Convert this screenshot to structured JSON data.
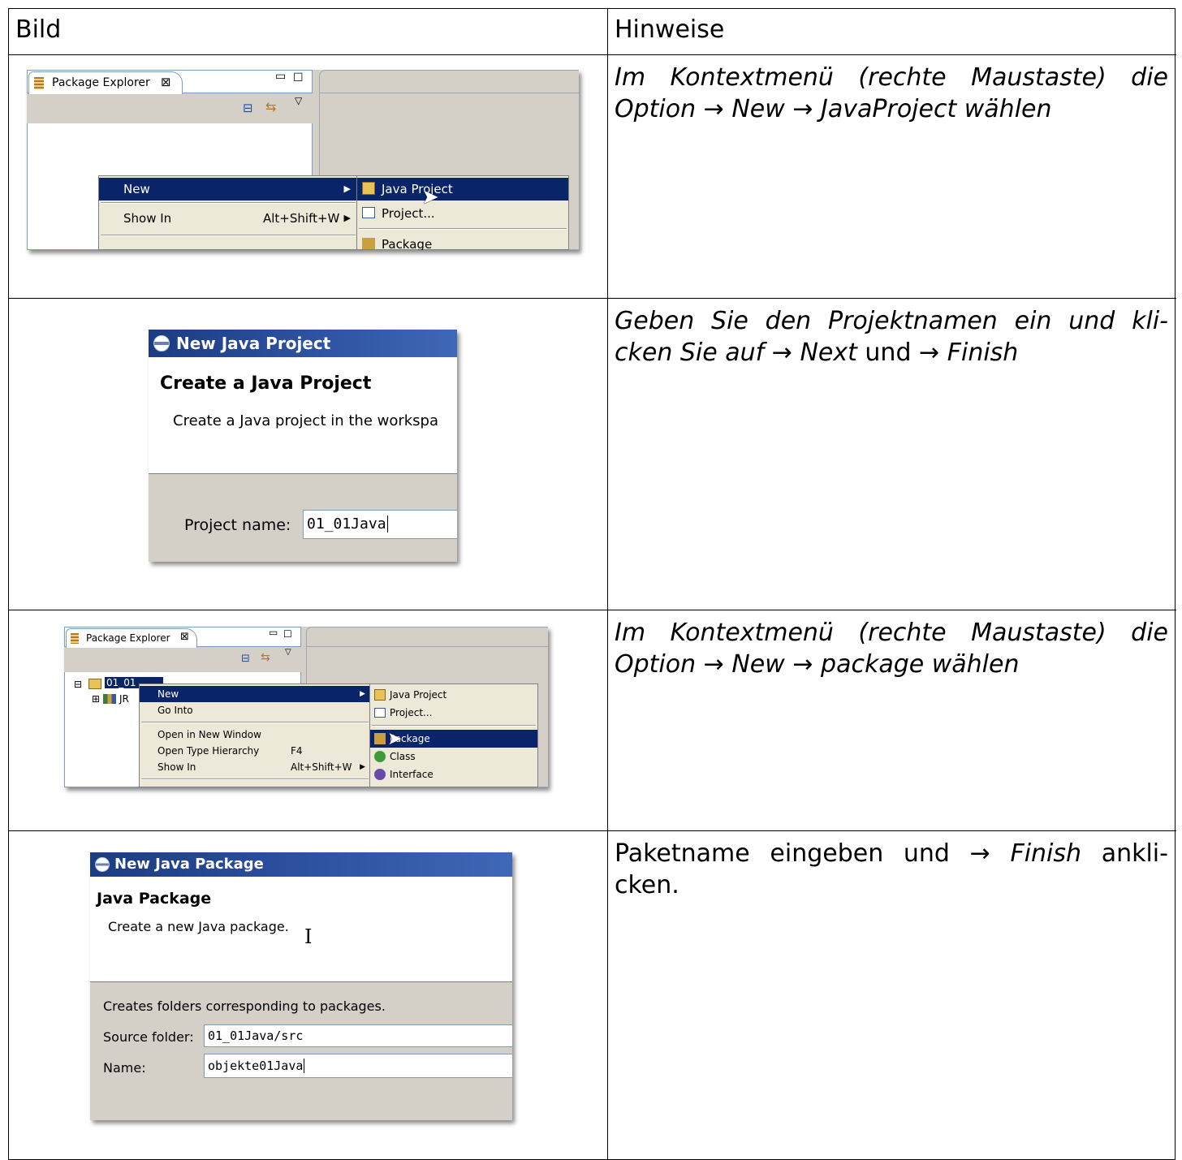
{
  "table": {
    "header": {
      "left": "Bild",
      "right": "Hinweise"
    }
  },
  "row1": {
    "note_prefix": "Im Kontextmenü (rechte Maustaste) die Option",
    "arrow1": "→",
    "new": "New",
    "arrow2": "→",
    "target": "JavaProject wählen",
    "ui": {
      "tab_label": "Package Explorer",
      "menu_new": "New",
      "menu_showin": "Show In",
      "menu_showin_shortcut": "Alt+Shift+W",
      "sub_java_project": "Java Project",
      "sub_project": "Project...",
      "sub_package": "Package"
    }
  },
  "row2": {
    "note_part1": "Geben Sie den Projektnamen ein und kli-cken Sie auf",
    "arrow1": "→",
    "next": "Next",
    "und": "und",
    "arrow2": "→",
    "finish": "Finish",
    "ui": {
      "title": "New Java Project",
      "heading": "Create a Java Project",
      "desc": "Create a Java project in the workspa",
      "label": "Project name:",
      "value": "01_01Java"
    }
  },
  "row3": {
    "note_prefix": "Im Kontextmenü (rechte Maustaste) die Option",
    "arrow1": "→",
    "new": "New",
    "arrow2": "→",
    "target": "package wählen",
    "ui": {
      "tab_label": "Package Explorer",
      "tree_project": "01_01",
      "tree_jre": "JR",
      "menu_new": "New",
      "menu_gointo": "Go Into",
      "menu_open_window": "Open in New Window",
      "menu_type_hierarchy": "Open Type Hierarchy",
      "menu_type_shortcut": "F4",
      "menu_showin": "Show In",
      "menu_showin_shortcut": "Alt+Shift+W",
      "sub_java_project": "Java Project",
      "sub_project": "Project...",
      "sub_package": "Package",
      "sub_class": "Class",
      "sub_interface": "Interface"
    }
  },
  "row4": {
    "note_part1": "Paketname eingeben und",
    "arrow": "→",
    "finish": "Finish",
    "note_part2": "ankli-cken.",
    "ui": {
      "title": "New Java Package",
      "heading": "Java Package",
      "desc": "Create a new Java package.",
      "info": "Creates folders corresponding to packages.",
      "source_label": "Source folder:",
      "source_value": "01_01Java/src",
      "name_label": "Name:",
      "name_value": "objekte01Java"
    }
  },
  "colors": {
    "menu_selection": "#0a246a",
    "title_bar": "#2f55a4",
    "dialog_bg": "#d4d0c8"
  }
}
